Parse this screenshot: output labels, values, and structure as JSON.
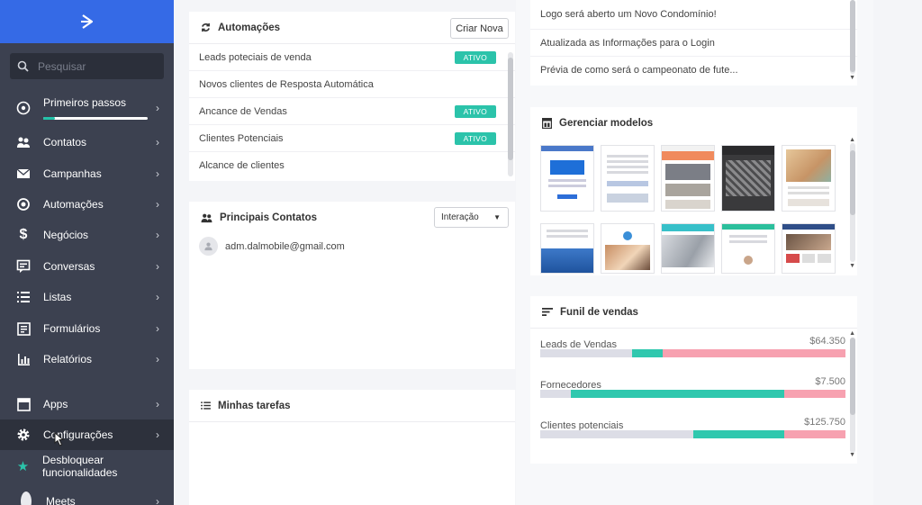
{
  "sidebar": {
    "search_placeholder": "Pesquisar",
    "items": [
      {
        "label": "Primeiros passos",
        "icon": "rocket-icon",
        "progress_pct": 11
      },
      {
        "label": "Contatos",
        "icon": "contacts-icon"
      },
      {
        "label": "Campanhas",
        "icon": "envelope-icon"
      },
      {
        "label": "Automações",
        "icon": "automation-icon"
      },
      {
        "label": "Negócios",
        "icon": "dollar-icon"
      },
      {
        "label": "Conversas",
        "icon": "chat-icon"
      },
      {
        "label": "Listas",
        "icon": "list-icon"
      },
      {
        "label": "Formulários",
        "icon": "form-icon"
      },
      {
        "label": "Relatórios",
        "icon": "bar-chart-icon"
      },
      {
        "label": "Apps",
        "icon": "apps-icon"
      },
      {
        "label": "Configurações",
        "icon": "gear-icon"
      },
      {
        "label": "Desbloquear funcionalidades",
        "icon": "star-icon"
      },
      {
        "label": "Meets",
        "icon": "avatar-icon"
      }
    ]
  },
  "automacoes": {
    "title": "Automações",
    "create_button": "Criar Nova",
    "rows": [
      {
        "name": "Leads poteciais de venda",
        "status": "ATIVO"
      },
      {
        "name": "Novos clientes de Resposta Automática",
        "status": ""
      },
      {
        "name": "Ancance de Vendas",
        "status": "ATIVO"
      },
      {
        "name": "Clientes Potenciais",
        "status": "ATIVO"
      },
      {
        "name": "Alcance de clientes",
        "status": ""
      }
    ]
  },
  "contatos": {
    "title": "Principais Contatos",
    "filter_value": "Interação",
    "items": [
      {
        "email": "adm.dalmobile@gmail.com"
      }
    ]
  },
  "tarefas": {
    "title": "Minhas tarefas"
  },
  "noticias": {
    "items": [
      "Logo será aberto um Novo Condomínio!",
      "Atualizada as Informações para o Login",
      "Prévia de como será o campeonato de fute..."
    ]
  },
  "modelos": {
    "title": "Gerenciar modelos"
  },
  "funil": {
    "title": "Funil de vendas",
    "rows": [
      {
        "label": "Leads de Vendas",
        "value": "$64.350",
        "segments_pct": [
          30,
          10,
          60
        ]
      },
      {
        "label": "Fornecedores",
        "value": "$7.500",
        "segments_pct": [
          10,
          70,
          20
        ]
      },
      {
        "label": "Clientes potenciais",
        "value": "$125.750",
        "segments_pct": [
          50,
          30,
          20
        ]
      }
    ],
    "colors": {
      "neutral": "#dcdde6",
      "teal": "#2fc8ae",
      "pink": "#f7a1b0"
    }
  },
  "colors": {
    "brand": "#356ae6",
    "sidebar": "#3c4150",
    "active": "#2bc3aa"
  }
}
